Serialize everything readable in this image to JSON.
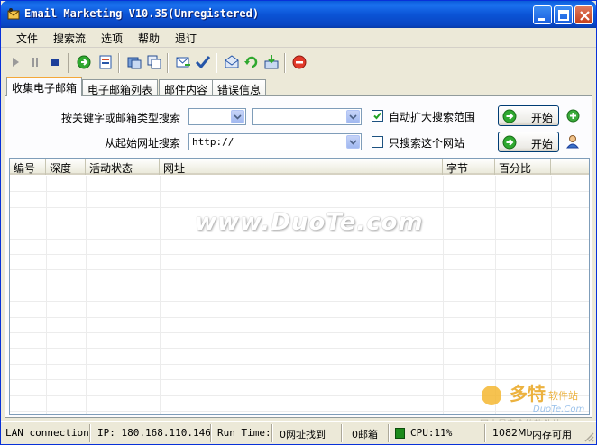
{
  "window": {
    "title": "Email Marketing V10.35(Unregistered)"
  },
  "menu": {
    "items": [
      "文件",
      "搜索流",
      "选项",
      "帮助",
      "退订"
    ]
  },
  "tabs": [
    "收集电子邮箱",
    "电子邮箱列表",
    "邮件内容",
    "错误信息"
  ],
  "form": {
    "keyword_label": "按关键字或邮箱类型搜索",
    "keyword_value_1": "",
    "keyword_value_2": "",
    "auto_expand_label": "自动扩大搜索范围",
    "auto_expand_checked": true,
    "url_label": "从起始网址搜索",
    "url_value": "http://",
    "only_site_label": "只搜索这个网站",
    "only_site_checked": false,
    "start_label": "开始"
  },
  "list": {
    "columns": [
      "编号",
      "深度",
      "活动状态",
      "网址",
      "字节",
      "百分比"
    ],
    "rows": []
  },
  "watermark": "www.DuoTe.com",
  "brand": {
    "logo_text": "多特",
    "sub_text": "软件站",
    "site_text": "DuoTe.Com",
    "tagline": "国内最安全的软件站"
  },
  "status": {
    "connection": "LAN connection",
    "ip": "IP: 180.168.110.146",
    "run_time_label": "Run Time:",
    "urls_found": "0网址找到",
    "emails": "0邮箱",
    "cpu": "CPU:11%",
    "memory_value": "1082Mb",
    "memory_label": "内存可用"
  },
  "colors": {
    "titlebar": "#0a5ad8",
    "face": "#ece9d8",
    "accent_tab": "#f4a83a"
  }
}
